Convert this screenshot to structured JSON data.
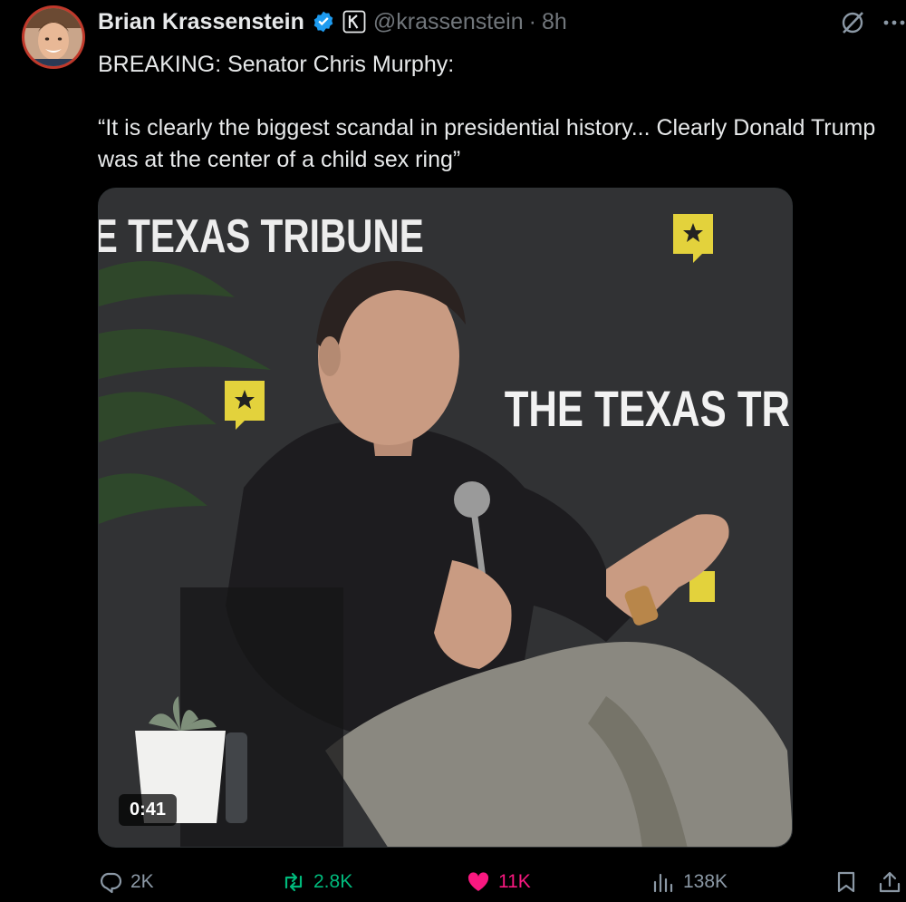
{
  "author": {
    "display_name": "Brian Krassenstein",
    "handle": "@krassenstein",
    "separator": "·",
    "time": "8h"
  },
  "tweet": {
    "line1": "BREAKING: Senator Chris Murphy:",
    "line2": "“It is clearly the biggest scandal in presidential history... Clearly Donald Trump was at the center of a child sex ring”"
  },
  "media": {
    "duration": "0:41",
    "backdrop_text_top": "E TEXAS TRIBUNE",
    "backdrop_text_mid": "THE TEXAS TRIB"
  },
  "actions": {
    "replies": "2K",
    "reposts": "2.8K",
    "likes": "11K",
    "views": "138K"
  },
  "colors": {
    "background": "#000000",
    "text": "#e7e9ea",
    "muted": "#71767b",
    "verified": "#1d9bf0",
    "repost": "#00ba7c",
    "like": "#f91880"
  },
  "icons": [
    "verified-badge-icon",
    "affiliate-k-icon",
    "grok-icon",
    "more-icon",
    "reply-icon",
    "retweet-icon",
    "heart-icon",
    "views-icon",
    "bookmark-icon",
    "share-icon"
  ]
}
